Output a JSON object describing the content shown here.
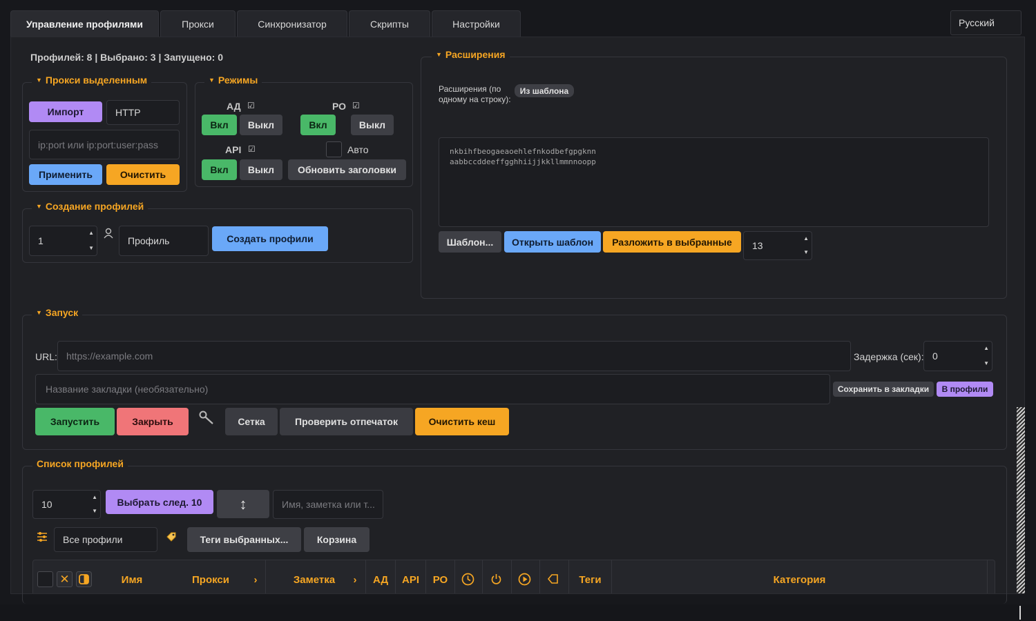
{
  "tabs": [
    {
      "label": "Управление профилями",
      "active": true
    },
    {
      "label": "Прокси",
      "active": false
    },
    {
      "label": "Синхронизатор",
      "active": false
    },
    {
      "label": "Скрипты",
      "active": false
    },
    {
      "label": "Настройки",
      "active": false
    }
  ],
  "language": "Русский",
  "stats": "Профилей: 8 | Выбрано: 3 | Запущено: 0",
  "proxy_group": {
    "title": "Прокси выделенным",
    "import_label": "Импорт",
    "type_value": "HTTP",
    "input_placeholder": "ip:port или ip:port:user:pass",
    "apply_label": "Применить",
    "clear_label": "Очистить"
  },
  "modes": {
    "title": "Режимы",
    "ad_label": "АД",
    "po_label": "РО",
    "api_label": "API",
    "on_label": "Вкл",
    "off_label": "Выкл",
    "auto_label": "Авто",
    "update_headers_label": "Обновить заголовки"
  },
  "create": {
    "title": "Создание профилей",
    "count_value": "1",
    "name_value": "Профиль",
    "create_label": "Создать профили"
  },
  "extensions": {
    "title": "Расширения",
    "desc_line1": "Расширения (по",
    "desc_line2": "одному на строку):",
    "from_template_label": "Из шаблона",
    "text_line1": "nkbihfbeogaeaoehlefnkodbefgpgknn",
    "text_line2": "aabbccddeeffgghhiijjkkllmmnnoopp",
    "template_label": "Шаблон...",
    "open_template_label": "Открыть шаблон",
    "distribute_label": "Разложить в выбранные",
    "number_value": "13"
  },
  "launch": {
    "title": "Запуск",
    "url_label": "URL:",
    "url_placeholder": "https://example.com",
    "delay_label": "Задержка (сек):",
    "delay_value": "0",
    "bookmark_placeholder": "Название закладки (необязательно)",
    "save_bookmarks_label": "Сохранить в закладки",
    "to_profiles_label": "В профили",
    "start_label": "Запустить",
    "close_label": "Закрыть",
    "grid_label": "Сетка",
    "fingerprint_label": "Проверить отпечаток",
    "clear_cache_label": "Очистить кеш"
  },
  "profiles": {
    "title": "Список профилей",
    "count_value": "10",
    "select_next_label": "Выбрать след. 10",
    "search_placeholder": "Имя, заметка или т...",
    "filter_value": "Все профили",
    "tags_selected_label": "Теги выбранных...",
    "trash_label": "Корзина",
    "columns": {
      "name": "Имя",
      "proxy": "Прокси",
      "note": "Заметка",
      "ad": "АД",
      "api": "API",
      "po": "РО",
      "tags": "Теги",
      "category": "Категория"
    }
  },
  "colors": {
    "accent": "#f6a623",
    "purple": "#b18af4",
    "blue": "#6aa8f8",
    "green": "#49b868",
    "red": "#f07578"
  }
}
